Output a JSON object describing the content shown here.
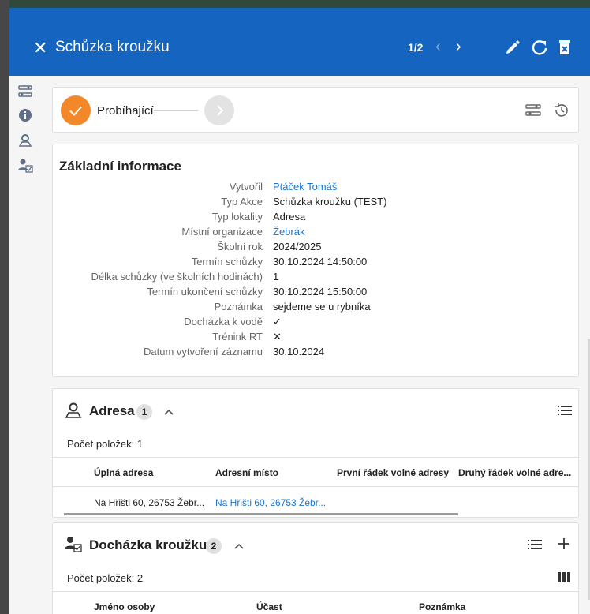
{
  "header": {
    "title": "Schůzka kroužku",
    "pager": "1/2",
    "prev": "‹",
    "next": "›"
  },
  "stepper": {
    "current_label": "Probíhající"
  },
  "info": {
    "title": "Základní informace",
    "rows": [
      {
        "label": "Vytvořil",
        "value": "Ptáček Tomáš",
        "link": true
      },
      {
        "label": "Typ Akce",
        "value": "Schůzka kroužku (TEST)"
      },
      {
        "label": "Typ lokality",
        "value": "Adresa"
      },
      {
        "label": "Místní organizace",
        "value": "Žebrák",
        "link": true
      },
      {
        "label": "Školní rok",
        "value": "2024/2025"
      },
      {
        "label": "Termín schůzky",
        "value": "30.10.2024 14:50:00"
      },
      {
        "label": "Délka schůzky (ve školních hodinách)",
        "value": "1"
      },
      {
        "label": "Termín ukončení schůzky",
        "value": "30.10.2024 15:50:00"
      },
      {
        "label": "Poznámka",
        "value": "sejdeme se u rybníka"
      },
      {
        "label": "Docházka k vodě",
        "value": "✓"
      },
      {
        "label": "Trénink RT",
        "value": "✕"
      },
      {
        "label": "Datum vytvoření záznamu",
        "value": "30.10.2024"
      }
    ]
  },
  "adresa": {
    "title": "Adresa",
    "badge": "1",
    "count": "Počet položek: 1",
    "columns": [
      "Úplná adresa",
      "Adresní místo",
      "První řádek volné adresy",
      "Druhý řádek volné adre..."
    ],
    "rows": [
      [
        "Na Hřišti 60, 26753 Žebr...",
        "Na Hřišti 60, 26753 Žebr...",
        "",
        ""
      ]
    ]
  },
  "dochazka": {
    "title": "Docházka kroužku",
    "badge": "2",
    "count": "Počet položek: 2",
    "columns": [
      "Jméno osoby",
      "Účast",
      "Poznámka"
    ]
  },
  "colors": {
    "header": "#1565c0",
    "accent": "#f2882a",
    "link": "#1976d2"
  }
}
